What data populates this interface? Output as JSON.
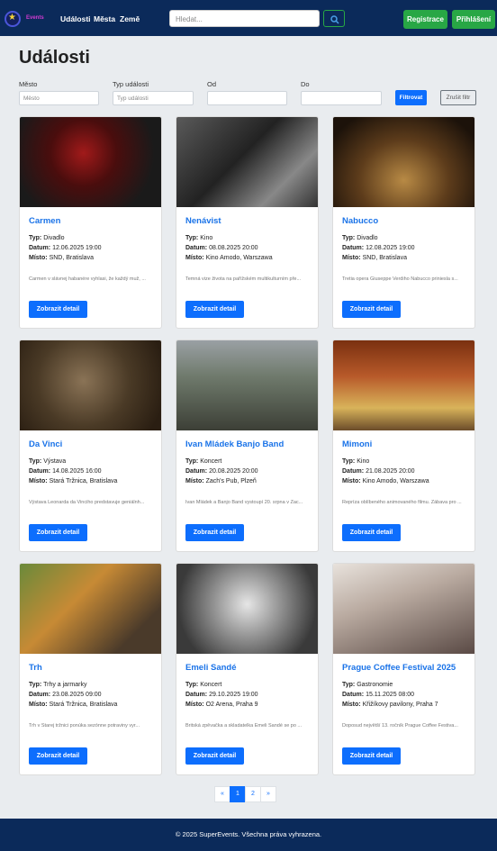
{
  "nav": {
    "logo_text": "Events",
    "links": [
      "Události",
      "Města",
      "Země"
    ],
    "search_placeholder": "Hledat...",
    "register_label": "Registrace",
    "login_label": "Přihlášení"
  },
  "page": {
    "title": "Události"
  },
  "filters": {
    "city_label": "Město",
    "city_placeholder": "Město",
    "type_label": "Typ události",
    "type_placeholder": "Typ události",
    "from_label": "Od",
    "to_label": "Do",
    "filter_button": "Filtrovat",
    "reset_button": "Zrušit filtr"
  },
  "labels": {
    "type": "Typ:",
    "date": "Datum:",
    "place": "Místo:",
    "detail_button": "Zobrazit detail"
  },
  "events": [
    {
      "title": "Carmen",
      "type": "Divadlo",
      "date": "12.06.2025 19:00",
      "place": "SND, Bratislava",
      "desc": "Carmen v slávnej habanére vyhlasi, že každý muž, ..."
    },
    {
      "title": "Nenávist",
      "type": "Kino",
      "date": "08.08.2025 20:00",
      "place": "Kino Amodo, Warszawa",
      "desc": "Temná vize života na pařížském multikulturním pře..."
    },
    {
      "title": "Nabucco",
      "type": "Divadlo",
      "date": "12.08.2025 19:00",
      "place": "SND, Bratislava",
      "desc": "Tretia opera Giuseppe Verdiho Nabucco priniesla s..."
    },
    {
      "title": "Da Vinci",
      "type": "Výstava",
      "date": "14.08.2025 16:00",
      "place": "Stará Tržnica, Bratislava",
      "desc": "Výstava Leonarda da Vinciho predstavuje geniálnh..."
    },
    {
      "title": "Ivan Mládek Banjo Band",
      "type": "Koncert",
      "date": "20.08.2025 20:00",
      "place": "Zach's Pub, Plzeň",
      "desc": "Ivan Mládek a Banjo Band vystoupí 20. srpna v Zac..."
    },
    {
      "title": "Mimoni",
      "type": "Kino",
      "date": "21.08.2025 20:00",
      "place": "Kino Amodo, Warszawa",
      "desc": "Repríza oblíbeného animovaného filmu. Zábava pro ..."
    },
    {
      "title": "Trh",
      "type": "Trhy a jarmarky",
      "date": "23.08.2025 09:00",
      "place": "Stará Tržnica, Bratislava",
      "desc": "Trh v Starej tržnici ponúka sezónne potraviny vyr..."
    },
    {
      "title": "Emeli Sandé",
      "type": "Koncert",
      "date": "29.10.2025 19:00",
      "place": "O2 Arena, Praha 9",
      "desc": "Britská zpěvačka a skladatelka Emeli Sandé se po ..."
    },
    {
      "title": "Prague Coffee Festival 2025",
      "type": "Gastronomie",
      "date": "15.11.2025 08:00",
      "place": "Křižíkovy pavilony, Praha 7",
      "desc": "Doposud největší 13. ročník Prague Coffee Festiva..."
    }
  ],
  "pagination": {
    "prev": "«",
    "pages": [
      "1",
      "2"
    ],
    "next": "»"
  },
  "footer": {
    "text": "© 2025 SuperEvents. Všechna práva vyhrazena."
  }
}
